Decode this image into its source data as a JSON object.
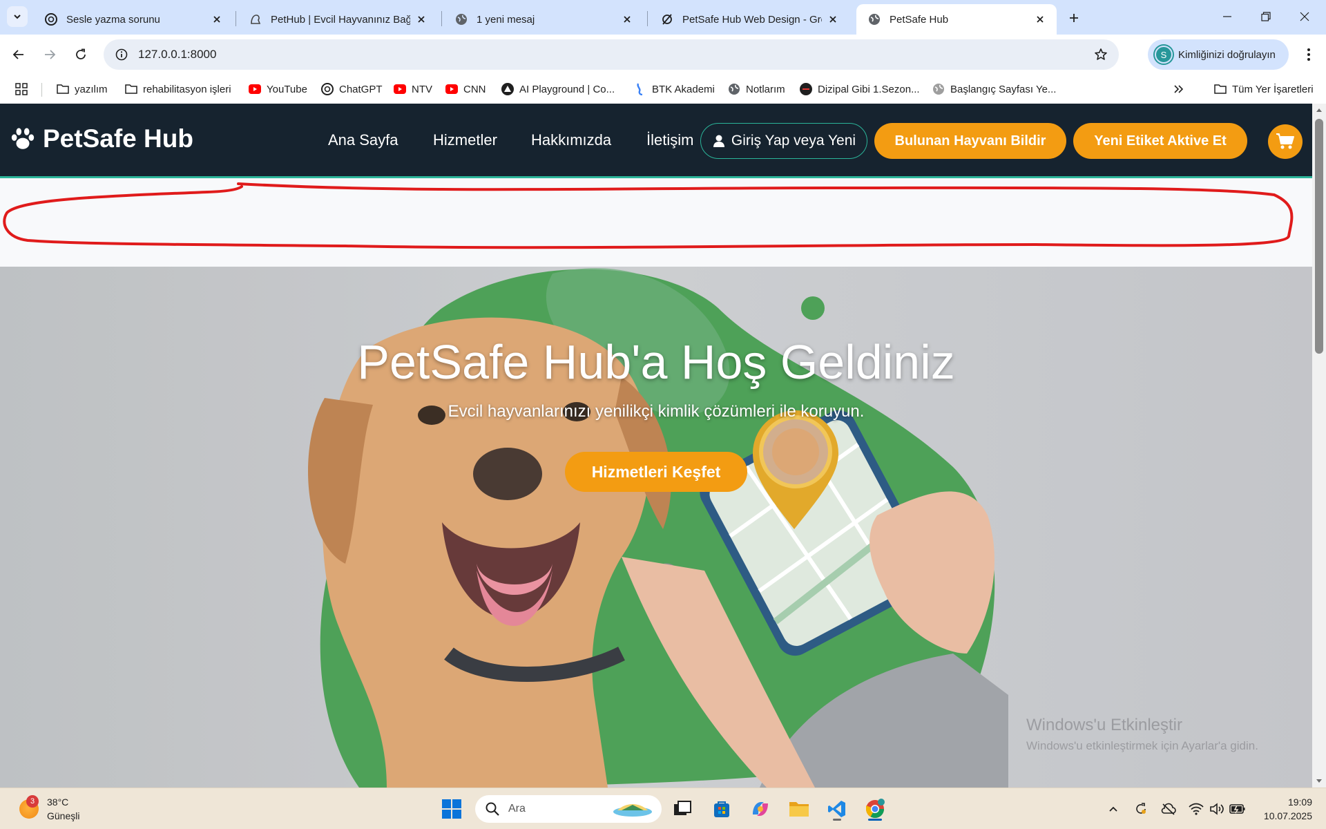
{
  "browser": {
    "tabs": [
      {
        "title": "Sesle yazma sorunu",
        "icon": "chatgpt-icon",
        "active": false
      },
      {
        "title": "PetHub | Evcil Hayvanınız Bağla",
        "icon": "pethub-icon",
        "active": false
      },
      {
        "title": "1 yeni mesaj",
        "icon": "globe-icon",
        "active": false
      },
      {
        "title": "PetSafe Hub Web Design - Grok",
        "icon": "grok-icon",
        "active": false
      },
      {
        "title": "PetSafe Hub",
        "icon": "globe-icon",
        "active": true
      }
    ],
    "address": "127.0.0.1:8000",
    "profile_label": "Kimliğinizi doğrulayın",
    "profile_initial": "S",
    "bookmarks": [
      {
        "label": "yazılım",
        "icon": "folder-icon"
      },
      {
        "label": "rehabilitasyon işleri",
        "icon": "folder-icon"
      },
      {
        "label": "YouTube",
        "icon": "youtube-icon"
      },
      {
        "label": "ChatGPT",
        "icon": "chatgpt-icon"
      },
      {
        "label": "NTV",
        "icon": "youtube-icon"
      },
      {
        "label": "CNN",
        "icon": "youtube-icon"
      },
      {
        "label": "AI Playground | Co...",
        "icon": "triangle-icon"
      },
      {
        "label": "BTK Akademi",
        "icon": "btk-icon"
      },
      {
        "label": "Notlarım",
        "icon": "globe-icon"
      },
      {
        "label": "Dizipal Gibi 1.Sezon...",
        "icon": "dizipal-icon"
      },
      {
        "label": "Başlangıç Sayfası Ye...",
        "icon": "globe-icon"
      }
    ],
    "all_bookmarks": "Tüm Yer İşaretleri"
  },
  "site": {
    "brand": "PetSafe Hub",
    "nav": [
      "Ana Sayfa",
      "Hizmetler",
      "Hakkımızda",
      "İletişim"
    ],
    "login": "Giriş Yap veya Yeni",
    "report_found": "Bulunan Hayvanı Bildir",
    "activate_tag": "Yeni Etiket Aktive Et",
    "hero_title": "PetSafe Hub'a Hoş Geldiniz",
    "hero_subtitle": "Evcil hayvanlarınızı yenilikçi kimlik çözümleri ile koruyun.",
    "hero_cta": "Hizmetleri Keşfet",
    "accent_color": "#f39c12",
    "nav_bg": "#16232f",
    "annotation_color": "#e01b1b"
  },
  "os": {
    "watermark_title": "Windows'u Etkinleştir",
    "watermark_sub": "Windows'u etkinleştirmek için Ayarlar'a gidin.",
    "weather_temp": "38°C",
    "weather_desc": "Güneşli",
    "weather_badge": "3",
    "search_placeholder": "Ara",
    "time": "19:09",
    "date": "10.07.2025"
  }
}
